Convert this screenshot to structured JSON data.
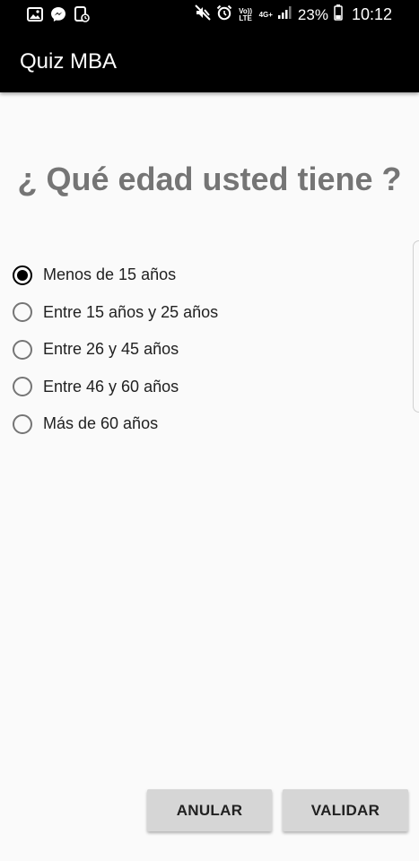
{
  "status_bar": {
    "left_icons": [
      "image-icon",
      "messenger-icon",
      "screen-record-icon"
    ],
    "right_icons": [
      "mute-icon",
      "alarm-icon",
      "volte-icon",
      "4g-icon",
      "signal-icon"
    ],
    "volte_label": "Vo)) LTE",
    "network_label": "4G+",
    "battery_percent": "23%",
    "time": "10:12"
  },
  "app_bar": {
    "title": "Quiz MBA"
  },
  "question": {
    "text": "¿ Qué edad usted tiene ?"
  },
  "options": [
    {
      "label": "Menos de 15 años",
      "selected": true
    },
    {
      "label": "Entre 15 años y 25 años",
      "selected": false
    },
    {
      "label": "Entre 26 y 45 años",
      "selected": false
    },
    {
      "label": "Entre 46 y 60 años",
      "selected": false
    },
    {
      "label": "Más de 60 años",
      "selected": false
    }
  ],
  "buttons": {
    "cancel_label": "ANULAR",
    "validate_label": "VALIDAR"
  }
}
